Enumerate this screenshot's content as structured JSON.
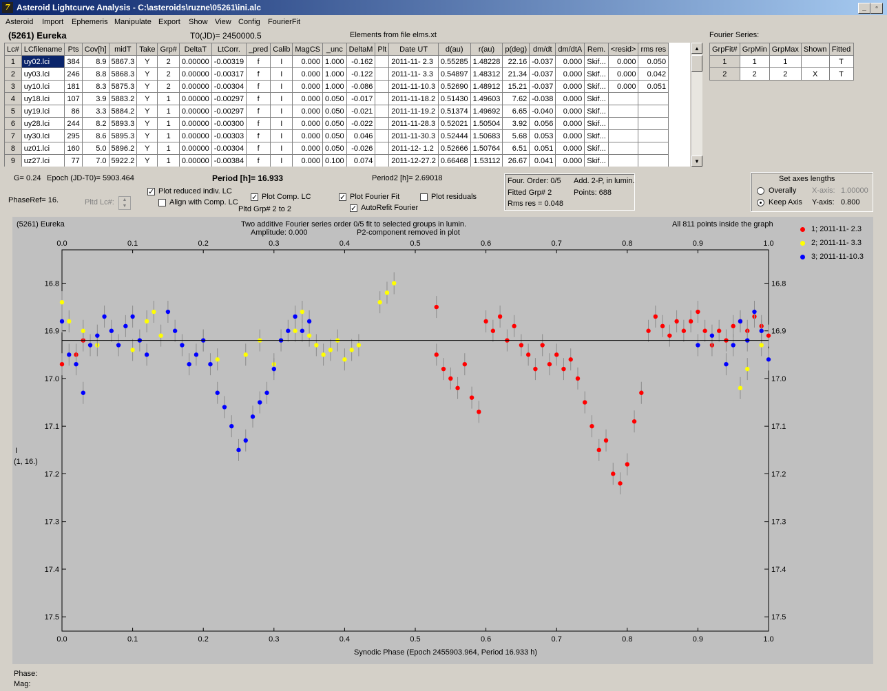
{
  "window": {
    "title": "Asteroid Lightcurve Analysis - C:\\asteroids\\ruzne\\05261\\ini.alc"
  },
  "menu": [
    "Asteroid",
    "Import",
    "Ephemeris",
    "Manipulate",
    "Export",
    "Show",
    "View",
    "Config",
    "FourierFit"
  ],
  "header": {
    "asteroid": "(5261) Eureka",
    "t0": "T0(JD)= 2450000.5",
    "elements": "Elements from file elms.xt"
  },
  "lc_table": {
    "columns": [
      "Lc#",
      "LCfilename",
      "Pts",
      "Cov[h]",
      "midT",
      "Take",
      "Grp#",
      "DeltaT",
      "LtCorr.",
      "_pred",
      "Calib",
      "MagCS",
      "_unc",
      "DeltaM",
      "Plt",
      "Date UT",
      "d(au)",
      "r(au)",
      "p(deg)",
      "dm/dt",
      "dm/dtA",
      "Rem.",
      "<resid>",
      "rms res"
    ],
    "rows": [
      [
        "1",
        "uy02.lci",
        "384",
        "8.9",
        "5867.3",
        "Y",
        "2",
        "0.00000",
        "-0.00319",
        "f",
        "I",
        "0.000",
        "1.000",
        "-0.162",
        "",
        "2011-11- 2.3",
        "0.55285",
        "1.48228",
        "22.16",
        "-0.037",
        "0.000",
        "Skif...",
        "0.000",
        "0.050"
      ],
      [
        "2",
        "uy03.lci",
        "246",
        "8.8",
        "5868.3",
        "Y",
        "2",
        "0.00000",
        "-0.00317",
        "f",
        "I",
        "0.000",
        "1.000",
        "-0.122",
        "",
        "2011-11- 3.3",
        "0.54897",
        "1.48312",
        "21.34",
        "-0.037",
        "0.000",
        "Skif...",
        "0.000",
        "0.042"
      ],
      [
        "3",
        "uy10.lci",
        "181",
        "8.3",
        "5875.3",
        "Y",
        "2",
        "0.00000",
        "-0.00304",
        "f",
        "I",
        "0.000",
        "1.000",
        "-0.086",
        "",
        "2011-11-10.3",
        "0.52690",
        "1.48912",
        "15.21",
        "-0.037",
        "0.000",
        "Skif...",
        "0.000",
        "0.051"
      ],
      [
        "4",
        "uy18.lci",
        "107",
        "3.9",
        "5883.2",
        "Y",
        "1",
        "0.00000",
        "-0.00297",
        "f",
        "I",
        "0.000",
        "0.050",
        "-0.017",
        "",
        "2011-11-18.2",
        "0.51430",
        "1.49603",
        "7.62",
        "-0.038",
        "0.000",
        "Skif...",
        "",
        ""
      ],
      [
        "5",
        "uy19.lci",
        "86",
        "3.3",
        "5884.2",
        "Y",
        "1",
        "0.00000",
        "-0.00297",
        "f",
        "I",
        "0.000",
        "0.050",
        "-0.021",
        "",
        "2011-11-19.2",
        "0.51374",
        "1.49692",
        "6.65",
        "-0.040",
        "0.000",
        "Skif...",
        "",
        ""
      ],
      [
        "6",
        "uy28.lci",
        "244",
        "8.2",
        "5893.3",
        "Y",
        "1",
        "0.00000",
        "-0.00300",
        "f",
        "I",
        "0.000",
        "0.050",
        "-0.022",
        "",
        "2011-11-28.3",
        "0.52021",
        "1.50504",
        "3.92",
        "0.056",
        "0.000",
        "Skif...",
        "",
        ""
      ],
      [
        "7",
        "uy30.lci",
        "295",
        "8.6",
        "5895.3",
        "Y",
        "1",
        "0.00000",
        "-0.00303",
        "f",
        "I",
        "0.000",
        "0.050",
        "0.046",
        "",
        "2011-11-30.3",
        "0.52444",
        "1.50683",
        "5.68",
        "0.053",
        "0.000",
        "Skif...",
        "",
        ""
      ],
      [
        "8",
        "uz01.lci",
        "160",
        "5.0",
        "5896.2",
        "Y",
        "1",
        "0.00000",
        "-0.00304",
        "f",
        "I",
        "0.000",
        "0.050",
        "-0.026",
        "",
        "2011-12- 1.2",
        "0.52666",
        "1.50764",
        "6.51",
        "0.051",
        "0.000",
        "Skif...",
        "",
        ""
      ],
      [
        "9",
        "uz27.lci",
        "77",
        "7.0",
        "5922.2",
        "Y",
        "1",
        "0.00000",
        "-0.00384",
        "f",
        "I",
        "0.000",
        "0.100",
        "0.074",
        "",
        "2011-12-27.2",
        "0.66468",
        "1.53112",
        "26.67",
        "0.041",
        "0.000",
        "Skif...",
        "",
        ""
      ]
    ]
  },
  "fourier_series": {
    "label": "Fourier Series:",
    "columns": [
      "GrpFit#",
      "GrpMin",
      "GrpMax",
      "Shown",
      "Fitted"
    ],
    "rows": [
      [
        "1",
        "1",
        "1",
        "",
        "T"
      ],
      [
        "2",
        "2",
        "2",
        "X",
        "T"
      ]
    ]
  },
  "controls": {
    "g": "G= 0.24",
    "epoch": "Epoch (JD-T0)= 5903.464",
    "period": "Period [h]= 16.933",
    "period2": "Period2 [h]= 2.69018",
    "phaseref": "PhaseRef= 16.",
    "pltd_lc": "Pltd Lc#:",
    "plot_reduced": "Plot reduced indiv. LC",
    "align_comp": "Align with Comp. LC",
    "plot_comp": "Plot Comp. LC",
    "pltd_grp": "Pltd Grp#  2   to   2",
    "plot_fourier": "Plot Fourier Fit",
    "plot_residuals": "Plot residuals",
    "autorefit": "AutoRefit Fourier",
    "plot_reduced_checked": true,
    "align_comp_checked": false,
    "plot_comp_checked": true,
    "plot_fourier_checked": true,
    "plot_residuals_checked": false,
    "autorefit_checked": true
  },
  "fit_info": {
    "four_order": "Four. Order:  0/5",
    "add": "Add. 2-P, in lumin.",
    "fitted_grp": "Fitted Grp# 2",
    "points": "Points: 688",
    "rms": "Rms res      = 0.048"
  },
  "axes_panel": {
    "title": "Set axes lengths",
    "overally": "Overally",
    "keep_axis": "Keep Axis",
    "x_axis_label": "X-axis:",
    "x_axis_value": "1.00000",
    "y_axis_label": "Y-axis:",
    "y_axis_value": "0.800",
    "selected": "keep_axis"
  },
  "footer": {
    "phase": "Phase:",
    "mag": "Mag:"
  },
  "chart_data": {
    "type": "scatter",
    "title_left": "(5261) Eureka",
    "title": "Two additive Fourier series order 0/5 fit to selected groups in lumin.",
    "subtitle_a": "Amplitude: 0.000",
    "subtitle_b": "P2-component removed in plot",
    "note_right": "All 811 points inside the graph",
    "xlabel": "Synodic Phase (Epoch 2455903.964, Period 16.933 h)",
    "ylabel": [
      "I",
      "(1, 16.)"
    ],
    "xlim": [
      0.0,
      1.0
    ],
    "ylim": [
      16.73,
      17.53
    ],
    "y_inverted": true,
    "xticks": [
      "0.0",
      "0.1",
      "0.2",
      "0.3",
      "0.4",
      "0.5",
      "0.6",
      "0.7",
      "0.8",
      "0.9",
      "1.0"
    ],
    "yticks": [
      "16.8",
      "16.9",
      "17.0",
      "17.1",
      "17.2",
      "17.3",
      "17.4",
      "17.5"
    ],
    "fit_line_y": 16.92,
    "colors": {
      "plot_bg": "#c0c0c0",
      "series1": "#ff0000",
      "series2": "#ffff00",
      "series3": "#0000ff",
      "errorbar": "#8c8c8c"
    },
    "series": [
      {
        "name": "1; 2011-11- 2.3",
        "color": "#ff0000",
        "points": [
          [
            0.0,
            16.97
          ],
          [
            0.02,
            16.95
          ],
          [
            0.03,
            16.92
          ],
          [
            0.53,
            16.85
          ],
          [
            0.53,
            16.95
          ],
          [
            0.54,
            16.98
          ],
          [
            0.55,
            17.0
          ],
          [
            0.56,
            17.02
          ],
          [
            0.57,
            16.97
          ],
          [
            0.58,
            17.04
          ],
          [
            0.59,
            17.07
          ],
          [
            0.6,
            16.88
          ],
          [
            0.61,
            16.9
          ],
          [
            0.62,
            16.87
          ],
          [
            0.63,
            16.92
          ],
          [
            0.64,
            16.89
          ],
          [
            0.65,
            16.93
          ],
          [
            0.66,
            16.95
          ],
          [
            0.67,
            16.98
          ],
          [
            0.68,
            16.93
          ],
          [
            0.69,
            16.97
          ],
          [
            0.7,
            16.95
          ],
          [
            0.71,
            16.98
          ],
          [
            0.72,
            16.96
          ],
          [
            0.73,
            17.0
          ],
          [
            0.74,
            17.05
          ],
          [
            0.75,
            17.1
          ],
          [
            0.76,
            17.15
          ],
          [
            0.77,
            17.13
          ],
          [
            0.78,
            17.2
          ],
          [
            0.79,
            17.22
          ],
          [
            0.8,
            17.18
          ],
          [
            0.81,
            17.09
          ],
          [
            0.82,
            17.03
          ],
          [
            0.83,
            16.9
          ],
          [
            0.84,
            16.87
          ],
          [
            0.85,
            16.89
          ],
          [
            0.86,
            16.91
          ],
          [
            0.87,
            16.88
          ],
          [
            0.88,
            16.9
          ],
          [
            0.89,
            16.88
          ],
          [
            0.9,
            16.86
          ],
          [
            0.91,
            16.9
          ],
          [
            0.92,
            16.93
          ],
          [
            0.93,
            16.9
          ],
          [
            0.94,
            16.92
          ],
          [
            0.95,
            16.89
          ],
          [
            0.96,
            16.88
          ],
          [
            0.97,
            16.9
          ],
          [
            0.98,
            16.87
          ],
          [
            0.99,
            16.89
          ],
          [
            1.0,
            16.91
          ]
        ]
      },
      {
        "name": "2; 2011-11- 3.3",
        "color": "#ffff00",
        "points": [
          [
            0.0,
            16.84
          ],
          [
            0.01,
            16.88
          ],
          [
            0.03,
            16.9
          ],
          [
            0.05,
            16.93
          ],
          [
            0.1,
            16.94
          ],
          [
            0.12,
            16.88
          ],
          [
            0.13,
            16.86
          ],
          [
            0.14,
            16.91
          ],
          [
            0.2,
            16.92
          ],
          [
            0.22,
            16.96
          ],
          [
            0.26,
            16.95
          ],
          [
            0.28,
            16.92
          ],
          [
            0.3,
            16.97
          ],
          [
            0.33,
            16.9
          ],
          [
            0.34,
            16.86
          ],
          [
            0.35,
            16.91
          ],
          [
            0.36,
            16.93
          ],
          [
            0.37,
            16.95
          ],
          [
            0.38,
            16.94
          ],
          [
            0.39,
            16.92
          ],
          [
            0.4,
            16.96
          ],
          [
            0.41,
            16.94
          ],
          [
            0.42,
            16.93
          ],
          [
            0.45,
            16.84
          ],
          [
            0.46,
            16.82
          ],
          [
            0.47,
            16.8
          ],
          [
            1.0,
            16.96
          ],
          [
            0.97,
            16.98
          ],
          [
            0.96,
            17.02
          ],
          [
            0.99,
            16.93
          ]
        ]
      },
      {
        "name": "3; 2011-11-10.3",
        "color": "#0000ff",
        "points": [
          [
            0.0,
            16.88
          ],
          [
            0.01,
            16.95
          ],
          [
            0.02,
            16.97
          ],
          [
            0.03,
            17.03
          ],
          [
            0.04,
            16.93
          ],
          [
            0.05,
            16.91
          ],
          [
            0.06,
            16.87
          ],
          [
            0.07,
            16.9
          ],
          [
            0.08,
            16.93
          ],
          [
            0.09,
            16.89
          ],
          [
            0.1,
            16.87
          ],
          [
            0.11,
            16.92
          ],
          [
            0.12,
            16.95
          ],
          [
            0.15,
            16.86
          ],
          [
            0.16,
            16.9
          ],
          [
            0.17,
            16.93
          ],
          [
            0.18,
            16.97
          ],
          [
            0.19,
            16.95
          ],
          [
            0.2,
            16.92
          ],
          [
            0.21,
            16.97
          ],
          [
            0.22,
            17.03
          ],
          [
            0.23,
            17.06
          ],
          [
            0.24,
            17.1
          ],
          [
            0.25,
            17.15
          ],
          [
            0.26,
            17.13
          ],
          [
            0.27,
            17.08
          ],
          [
            0.28,
            17.05
          ],
          [
            0.29,
            17.03
          ],
          [
            0.3,
            16.98
          ],
          [
            0.31,
            16.92
          ],
          [
            0.32,
            16.9
          ],
          [
            0.33,
            16.87
          ],
          [
            0.34,
            16.9
          ],
          [
            0.35,
            16.88
          ],
          [
            0.9,
            16.93
          ],
          [
            0.92,
            16.91
          ],
          [
            0.94,
            16.97
          ],
          [
            0.95,
            16.93
          ],
          [
            0.96,
            16.88
          ],
          [
            0.97,
            16.92
          ],
          [
            0.98,
            16.86
          ],
          [
            0.99,
            16.9
          ],
          [
            1.0,
            16.96
          ]
        ]
      }
    ]
  }
}
